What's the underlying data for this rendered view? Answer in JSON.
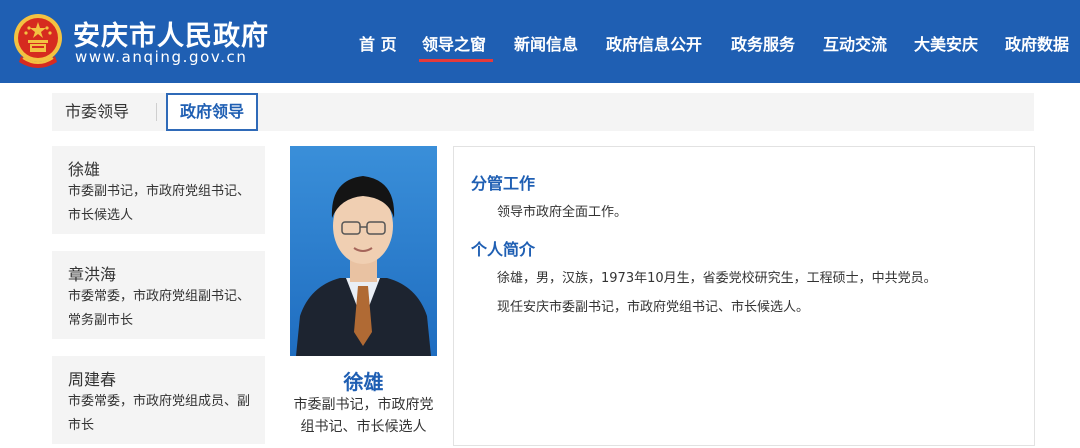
{
  "site": {
    "name": "安庆市人民政府",
    "url": "www.anqing.gov.cn"
  },
  "nav": {
    "items": [
      {
        "label": "首 页"
      },
      {
        "label": "领导之窗",
        "active": true
      },
      {
        "label": "新闻信息"
      },
      {
        "label": "政府信息公开"
      },
      {
        "label": "政务服务"
      },
      {
        "label": "互动交流"
      },
      {
        "label": "大美安庆"
      },
      {
        "label": "政府数据"
      }
    ]
  },
  "tabs": {
    "city_committee": "市委领导",
    "government": "政府领导",
    "active": "government"
  },
  "leaders": [
    {
      "name": "徐雄",
      "title": "市委副书记，市政府党组书记、市长候选人"
    },
    {
      "name": "章洪海",
      "title": "市委常委，市政府党组副书记、常务副市长"
    },
    {
      "name": "周建春",
      "title": "市委常委，市政府党组成员、副市长"
    }
  ],
  "profile": {
    "name": "徐雄",
    "title": "市委副书记，市政府党组书记、市长候选人",
    "duties_heading": "分管工作",
    "duties": "领导市政府全面工作。",
    "bio_heading": "个人简介",
    "bio_line1": "徐雄，男，汉族，1973年10月生，省委党校研究生，工程硕士，中共党员。",
    "bio_line2": "现任安庆市委副书记，市政府党组书记、市长候选人。"
  },
  "colors": {
    "header_blue": "#1f5fb3",
    "nav_active_underline": "#e53a3a",
    "panel_gray": "#f4f4f4"
  }
}
